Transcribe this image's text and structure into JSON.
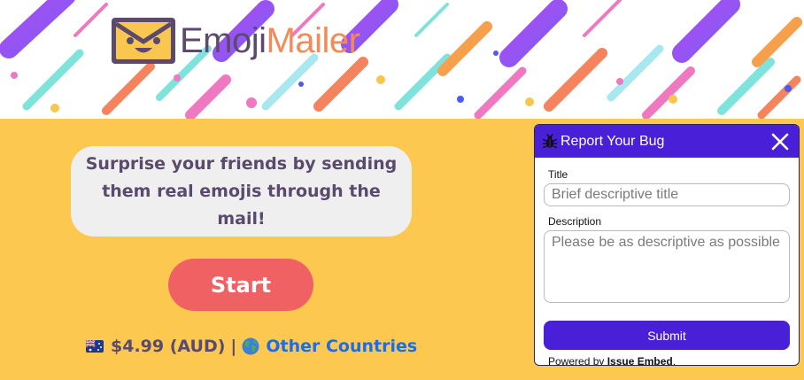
{
  "logo": {
    "text_part1": "Emoji",
    "text_part2": "Mailer"
  },
  "hero": {
    "tagline": "Surprise your friends by sending them real emojis through the mail!"
  },
  "start_button": {
    "label": "Start"
  },
  "pricing": {
    "price": "$4.99 (AUD)",
    "separator": "|",
    "other_countries_link": "Other Countries"
  },
  "bug_report": {
    "title": "Report Your Bug",
    "title_field": {
      "label": "Title",
      "placeholder": "Brief descriptive title",
      "value": ""
    },
    "description_field": {
      "label": "Description",
      "placeholder": "Please be as descriptive as possible",
      "value": ""
    },
    "submit_label": "Submit",
    "powered_prefix": "Powered by",
    "powered_brand": "Issue Embed",
    "powered_suffix": "."
  },
  "icons": {
    "logo": "envelope-smile-icon",
    "flag": "australia-flag-icon",
    "globe": "globe-icon",
    "bug": "bug-icon",
    "close": "close-icon"
  },
  "colors": {
    "background": "#fdc84f",
    "tagline_bg": "#efefef",
    "text_dark": "#5a4a6d",
    "start_button": "#f06164",
    "link": "#1a6fe8",
    "widget_accent": "#4a1fd8",
    "logo_accent": "#f28b57"
  }
}
